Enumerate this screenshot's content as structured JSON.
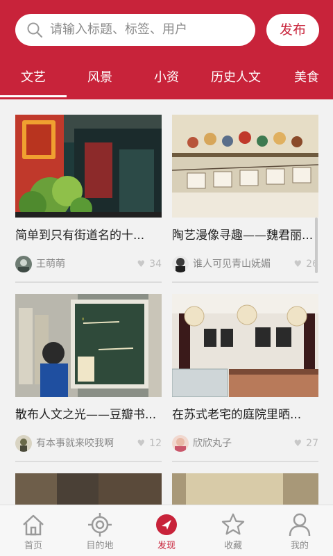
{
  "search": {
    "placeholder": "请输入标题、标签、用户"
  },
  "header": {
    "publish_label": "发布"
  },
  "tabs": [
    {
      "label": "文艺",
      "active": true
    },
    {
      "label": "风景"
    },
    {
      "label": "小资"
    },
    {
      "label": "历史人文"
    },
    {
      "label": "美食"
    }
  ],
  "cards": [
    {
      "title": "简单到只有街道名的十...",
      "user": "王萌萌",
      "likes": "34",
      "thumb_icon": "street-cafe-photo"
    },
    {
      "title": "陶艺漫像寻趣——魏君丽...",
      "user": "谁人可见青山妩媚",
      "likes": "26",
      "thumb_icon": "pottery-figurines-photo"
    },
    {
      "title": "散布人文之光——豆瓣书...",
      "user": "有本事就来咬我啊",
      "likes": "12",
      "thumb_icon": "bookstore-blackboard-photo"
    },
    {
      "title": "在苏式老宅的庭院里晒...",
      "user": "欣欣丸子",
      "likes": "27",
      "thumb_icon": "cafe-interior-photo"
    }
  ],
  "bottom_nav": [
    {
      "label": "首页",
      "icon": "home-icon"
    },
    {
      "label": "目的地",
      "icon": "target-icon"
    },
    {
      "label": "发现",
      "icon": "compass-icon",
      "active": true
    },
    {
      "label": "收藏",
      "icon": "star-icon"
    },
    {
      "label": "我的",
      "icon": "user-icon"
    }
  ],
  "colors": {
    "brand": "#c8233a",
    "tab_text": "#ffffff",
    "inactive_nav": "#8b8b8b"
  }
}
